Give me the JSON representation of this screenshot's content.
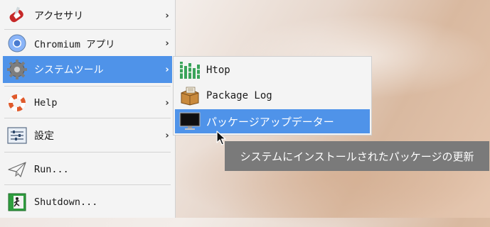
{
  "main_menu": {
    "items": [
      {
        "label": "アクセサリ",
        "icon": "swiss-knife-icon",
        "has_submenu": true
      },
      {
        "label": "Chromium アプリ",
        "icon": "chromium-icon",
        "has_submenu": true
      },
      {
        "label": "システムツール",
        "icon": "gear-icon",
        "has_submenu": true,
        "active": true
      },
      {
        "label": "Help",
        "icon": "lifebuoy-icon",
        "has_submenu": true
      },
      {
        "label": "設定",
        "icon": "settings-panel-icon",
        "has_submenu": true
      },
      {
        "label": "Run...",
        "icon": "paper-plane-icon",
        "has_submenu": false
      },
      {
        "label": "Shutdown...",
        "icon": "exit-icon",
        "has_submenu": false
      }
    ],
    "arrow_glyph": "›"
  },
  "submenu": {
    "items": [
      {
        "label": "Htop",
        "icon": "htop-icon"
      },
      {
        "label": "Package Log",
        "icon": "package-icon"
      },
      {
        "label": "パッケージアップデーター",
        "icon": "monitor-icon",
        "active": true
      }
    ]
  },
  "tooltip": {
    "text": "システムにインストールされたパッケージの更新"
  },
  "colors": {
    "accent": "#4f93e9",
    "menu_bg": "#f4f4f4",
    "tooltip_bg": "#7a7a7a"
  }
}
